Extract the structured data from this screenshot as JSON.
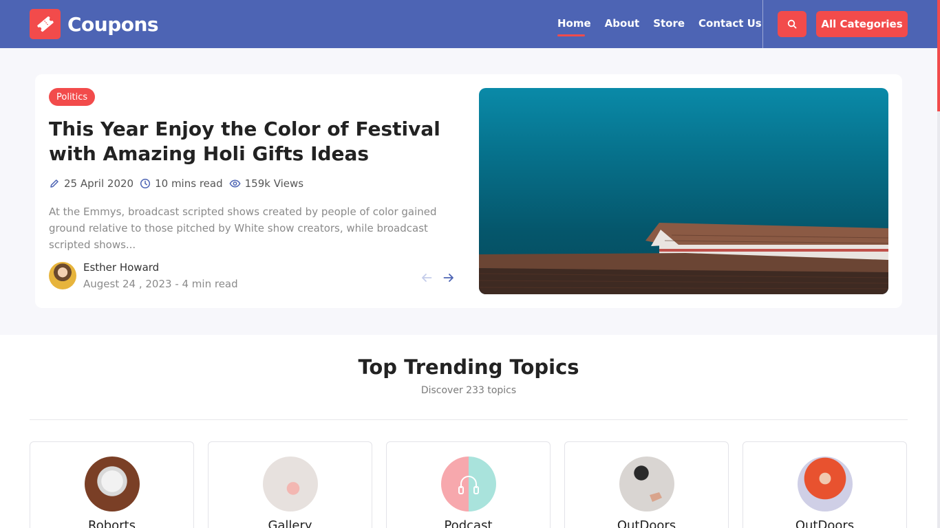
{
  "header": {
    "logo_text": "Coupons",
    "nav": [
      {
        "label": "Home",
        "active": true
      },
      {
        "label": "About"
      },
      {
        "label": "Store"
      },
      {
        "label": "Contact Us"
      }
    ],
    "search_icon": "search-icon",
    "categories_label": "All Categories"
  },
  "hero": {
    "badge": "Politics",
    "title": "This Year Enjoy the Color of Festival with Amazing Holi Gifts Ideas",
    "meta": {
      "date": "25 April 2020",
      "read_time": "10 mins read",
      "views": "159k Views"
    },
    "excerpt": "At the Emmys, broadcast scripted shows created by people of color gained ground relative to those pitched by White show creators, while broadcast scripted shows...",
    "author": {
      "name": "Esther Howard",
      "date": "Augest 24 , 2023 - 4 min read"
    }
  },
  "trending": {
    "title": "Top Trending Topics",
    "subtitle": "Discover 233 topics",
    "topics": [
      {
        "name": "Roborts"
      },
      {
        "name": "Gallery"
      },
      {
        "name": "Podcast"
      },
      {
        "name": "OutDoors"
      },
      {
        "name": "OutDoors"
      }
    ]
  },
  "colors": {
    "header_bg": "#4d64b4",
    "accent": "#f24b4b"
  }
}
